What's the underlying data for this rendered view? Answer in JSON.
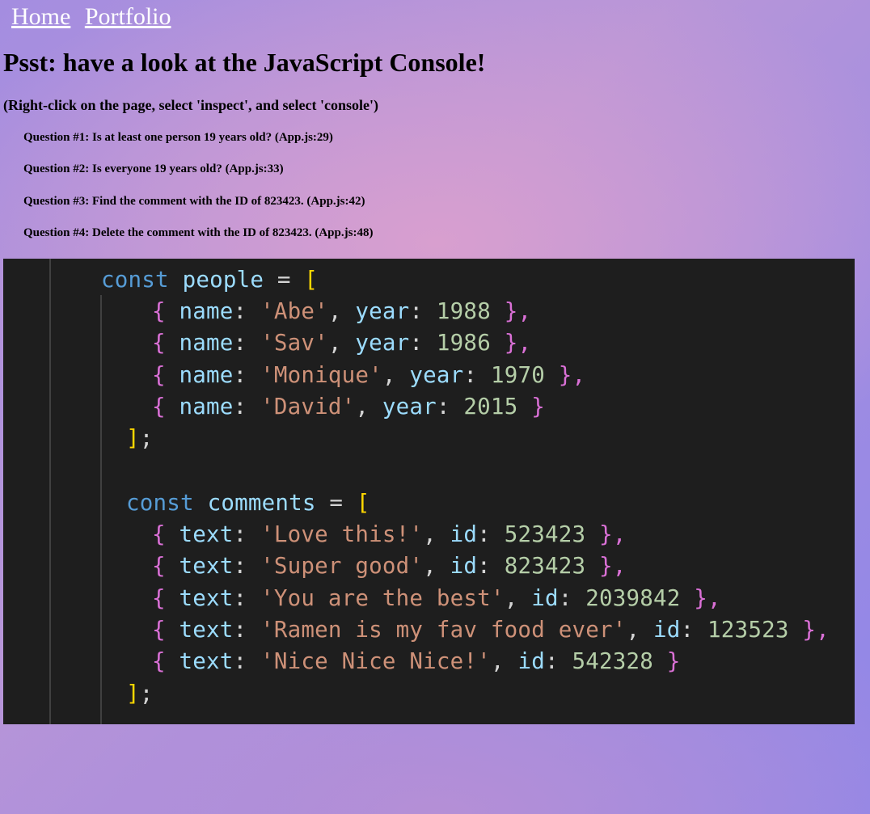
{
  "nav": {
    "home_label": "Home",
    "portfolio_label": "Portfolio"
  },
  "page": {
    "title": "Psst: have a look at the JavaScript Console!",
    "subtitle": "(Right-click on the page, select 'inspect', and select 'console')"
  },
  "questions": [
    "Question #1: Is at least one person 19 years old? (App.js:29)",
    "Question #2: Is everyone 19 years old? (App.js:33)",
    "Question #3: Find the comment with the ID of 823423. (App.js:42)",
    "Question #4: Delete the comment with the ID of 823423. (App.js:48)"
  ],
  "code": {
    "people_decl": "const",
    "people_name": "people",
    "people": [
      {
        "name": "'Abe'",
        "year": "1988",
        "trail": " },"
      },
      {
        "name": "'Sav'",
        "year": "1986",
        "trail": " },"
      },
      {
        "name": "'Monique'",
        "year": "1970",
        "trail": " },"
      },
      {
        "name": "'David'",
        "year": "2015",
        "trail": " }"
      }
    ],
    "comments_decl": "const",
    "comments_name": "comments",
    "comments": [
      {
        "text": "'Love this!'",
        "id": "523423",
        "trail": " },"
      },
      {
        "text": "'Super good'",
        "id": "823423",
        "trail": " },"
      },
      {
        "text": "'You are the best'",
        "id": "2039842",
        "trail": " },"
      },
      {
        "text": "'Ramen is my fav food ever'",
        "id": "123523",
        "trail": " },"
      },
      {
        "text": "'Nice Nice Nice!'",
        "id": "542328",
        "trail": " }"
      }
    ],
    "keys": {
      "name": "name",
      "year": "year",
      "text": "text",
      "id": "id"
    },
    "colors": {
      "background": "#1e1e1e",
      "keyword": "#569cd6",
      "variable": "#9cdcfe",
      "string": "#ce9178",
      "number": "#b5cea8",
      "bracket": "#ffd700",
      "brace": "#da70d6"
    }
  }
}
